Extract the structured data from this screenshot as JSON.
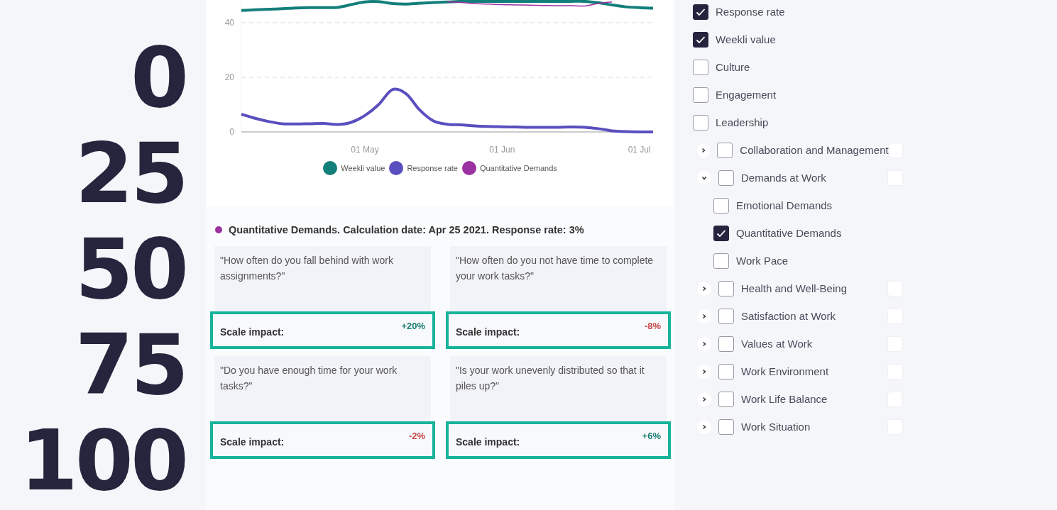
{
  "scale_labels": [
    "0",
    "25",
    "50",
    "75",
    "100"
  ],
  "chart": {
    "chart_data": {
      "type": "line",
      "categories": [
        null,
        null,
        null,
        null,
        null,
        null,
        null,
        null,
        null,
        "01 May",
        null,
        null,
        null,
        null,
        null,
        null,
        null,
        null,
        null,
        "01 Jun",
        null,
        null,
        null,
        null,
        null,
        null,
        null,
        null,
        null,
        "01 Jul",
        null
      ],
      "ylim": [
        0,
        48.3
      ],
      "yticks": [
        {
          "value": 0,
          "label": "0"
        },
        {
          "value": 20,
          "label": "20"
        },
        {
          "value": 40,
          "label": "40"
        }
      ],
      "series": [
        {
          "name": "Weekli value",
          "color": "#137f7a",
          "values": [
            44.5,
            44.7,
            44.9,
            45.1,
            45.4,
            45.5,
            45.5,
            45.6,
            46.6,
            47.6,
            47.7,
            47,
            46.8,
            47.1,
            47.4,
            47.6,
            47.8,
            47.8,
            47.8,
            47.8,
            47.8,
            47.8,
            47.8,
            47.8,
            47.8,
            47.8,
            47.3,
            46.5,
            45.8,
            45.5,
            45.3
          ]
        },
        {
          "name": "Response rate",
          "color": "#5a4fbf",
          "values": [
            6.5,
            5,
            3.8,
            3,
            2.9,
            3,
            3.1,
            2.7,
            3.5,
            6,
            10,
            15.5,
            14,
            8,
            4,
            2.8,
            2.6,
            2.2,
            2,
            1.9,
            1.8,
            1.7,
            1.7,
            1.7,
            1.8,
            1.7,
            1.2,
            0.4,
            0.1,
            0,
            0
          ]
        },
        {
          "name": "Quantitative Demands",
          "color": "#9b30a0",
          "values": [
            null,
            null,
            null,
            null,
            null,
            null,
            null,
            null,
            null,
            null,
            null,
            null,
            null,
            null,
            null,
            47.6,
            47.4,
            47,
            46.8,
            46.6,
            46.5,
            46.4,
            46.3,
            46.2,
            46.2,
            46.1,
            47,
            47.6,
            null,
            null,
            null
          ]
        }
      ]
    }
  },
  "summary": {
    "color": "#9b30a0",
    "text": "Quantitative Demands. Calculation date: Apr 25 2021. Response rate: 3%"
  },
  "questions": [
    {
      "question": "\"How often do you fall behind with work assignments?\"",
      "impact_label": "Scale impact:",
      "impact": "+20%",
      "color": "#1a7f73"
    },
    {
      "question": "\"How often do you not have time to complete your work tasks?\"",
      "impact_label": "Scale impact:",
      "impact": "-8%",
      "color": "#c84a4a"
    },
    {
      "question": "\"Do you have enough time for your work tasks?\"",
      "impact_label": "Scale impact:",
      "impact": "-2%",
      "color": "#c84a4a"
    },
    {
      "question": "\"Is your work unevenly distributed so that it piles up?\"",
      "impact_label": "Scale impact:",
      "impact": "+6%",
      "color": "#1a7f73"
    }
  ],
  "filters": [
    {
      "kind": "metric",
      "label": "Response rate",
      "checked": true
    },
    {
      "kind": "metric",
      "label": "Weekli value",
      "checked": true
    },
    {
      "kind": "metric",
      "label": "Culture",
      "checked": false
    },
    {
      "kind": "metric",
      "label": "Engagement",
      "checked": false
    },
    {
      "kind": "metric",
      "label": "Leadership",
      "checked": false
    },
    {
      "kind": "group",
      "label": "Collaboration and Management",
      "checked": false,
      "expanded": false,
      "option_checked": false
    },
    {
      "kind": "group",
      "label": "Demands at Work",
      "checked": false,
      "expanded": true,
      "option_checked": false,
      "children": [
        {
          "label": "Emotional Demands",
          "checked": false
        },
        {
          "label": "Quantitative Demands",
          "checked": true
        },
        {
          "label": "Work Pace",
          "checked": false
        }
      ]
    },
    {
      "kind": "group",
      "label": "Health and Well-Being",
      "checked": false,
      "expanded": false,
      "option_checked": false
    },
    {
      "kind": "group",
      "label": "Satisfaction at Work",
      "checked": false,
      "expanded": false,
      "option_checked": false
    },
    {
      "kind": "group",
      "label": "Values at Work",
      "checked": false,
      "expanded": false,
      "option_checked": false
    },
    {
      "kind": "group",
      "label": "Work Environment",
      "checked": false,
      "expanded": false,
      "option_checked": false
    },
    {
      "kind": "group",
      "label": "Work Life Balance",
      "checked": false,
      "expanded": false,
      "option_checked": false
    },
    {
      "kind": "group",
      "label": "Work Situation",
      "checked": false,
      "expanded": false,
      "option_checked": false
    }
  ]
}
